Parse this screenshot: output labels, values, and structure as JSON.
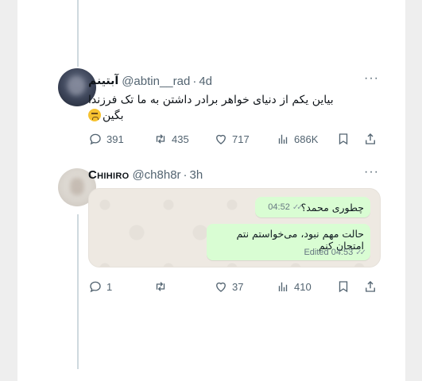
{
  "tweet1": {
    "display_name": "آبتینم",
    "handle": "@abtin__rad",
    "time": "4d",
    "text_line1": "بیاین یکم از دنیای خواهر برادر داشتن به ما تک فرزندا",
    "text_line2": "بگین",
    "emoji": "weary-face",
    "stats": {
      "replies": "391",
      "reposts": "435",
      "likes": "717",
      "views": "686K"
    }
  },
  "tweet2": {
    "display_name": "Chihiro",
    "handle": "@ch8h8r",
    "time": "3h",
    "stats": {
      "replies": "1",
      "reposts": "",
      "likes": "37",
      "views": "410"
    },
    "chat": {
      "messages": [
        {
          "text": "چطوری محمد؟",
          "meta": "04:52"
        },
        {
          "text": "حالت مهم نبود، می‌خواستم نتم امتحان کنم",
          "meta": "Edited 04:53"
        }
      ]
    }
  },
  "separator_dot": "·",
  "more_label": "···",
  "colors": {
    "text": "#0f1419",
    "muted": "#536471",
    "bubble": "#d9fdd3",
    "chat_bg": "#eee9e2"
  }
}
